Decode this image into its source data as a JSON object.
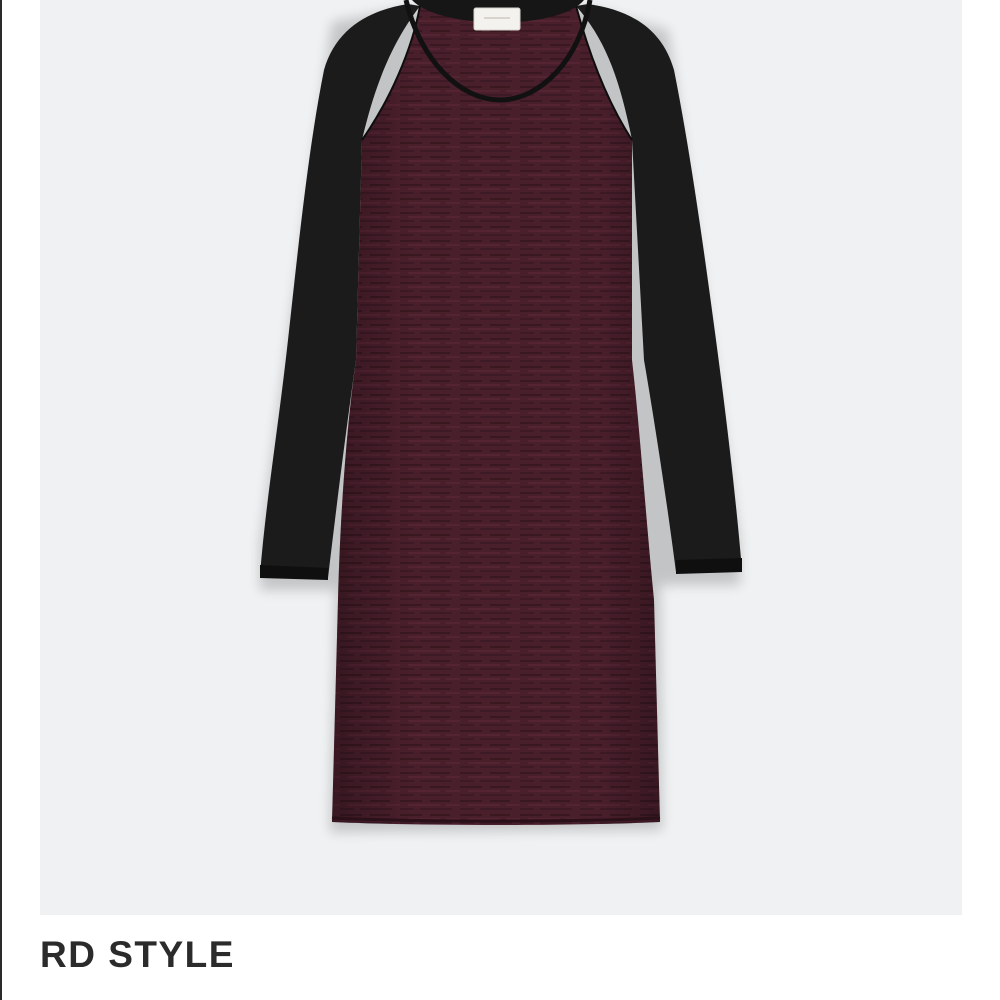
{
  "product": {
    "brand": "RD STYLE",
    "image": {
      "subject": "dress-image",
      "body_color": "#4a1f2c",
      "sleeve_color": "#1b1b1b",
      "background_color": "#eff1f3"
    }
  }
}
